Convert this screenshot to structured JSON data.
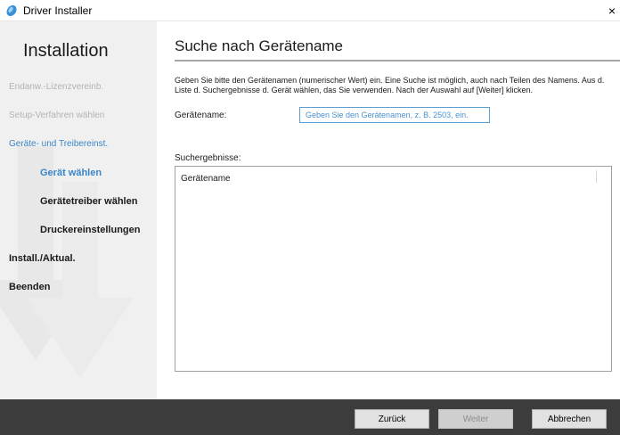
{
  "window": {
    "title": "Driver Installer",
    "close": "×"
  },
  "sidebar": {
    "heading": "Installation",
    "steps": [
      {
        "label": "Endanw.-Lizenzvereinb.",
        "state": "done"
      },
      {
        "label": "Setup-Verfahren wählen",
        "state": "done"
      },
      {
        "label": "Geräte- und Treibereinst.",
        "state": "active"
      },
      {
        "label": "Gerät wählen",
        "state": "current"
      },
      {
        "label": "Gerätetreiber wählen",
        "state": "pending"
      },
      {
        "label": "Druckereinstellungen",
        "state": "pending"
      },
      {
        "label": "Install./Aktual.",
        "state": "pending"
      },
      {
        "label": "Beenden",
        "state": "pending"
      }
    ]
  },
  "main": {
    "title": "Suche nach Gerätename",
    "description": "Geben Sie bitte den Gerätenamen (numerischer Wert) ein. Eine Suche ist möglich, auch nach Teilen des Namens. Aus d. Liste d. Suchergebnisse d. Gerät wählen, das Sie verwenden. Nach der Auswahl auf [Weiter] klicken.",
    "device_name_label": "Gerätename:",
    "device_name_placeholder": "Geben Sie den Gerätenamen, z. B. 2503, ein.",
    "device_name_value": "",
    "results_label": "Suchergebnisse:",
    "results_column_header": "Gerätename"
  },
  "footer": {
    "back": "Zurück",
    "next": "Weiter",
    "next_disabled": true,
    "cancel": "Abbrechen"
  },
  "colors": {
    "accent": "#3a86c8",
    "footer": "#3c3c3c",
    "sidebar": "#f0f0f0"
  }
}
